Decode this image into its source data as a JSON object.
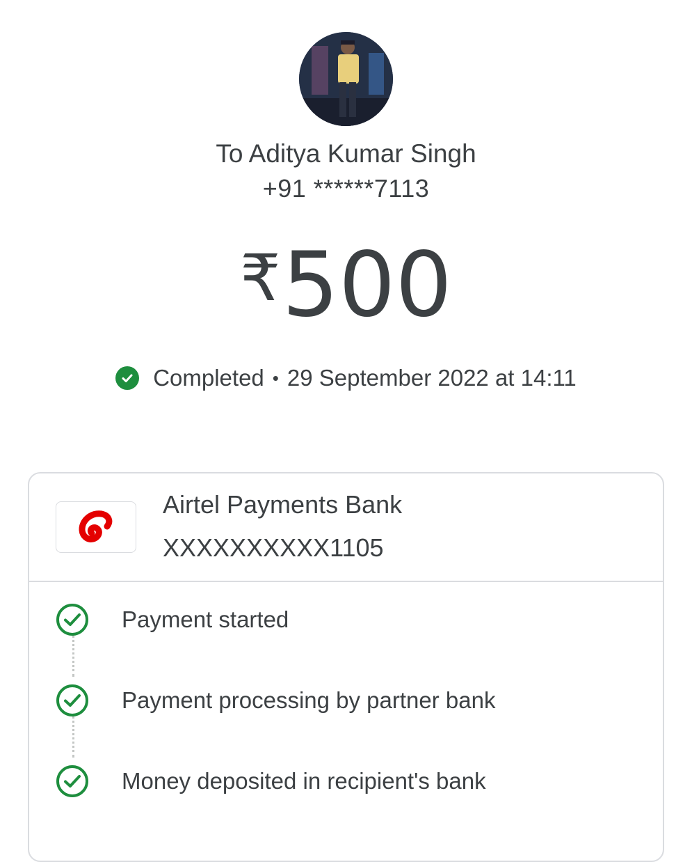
{
  "recipient": {
    "name": "To Aditya Kumar Singh",
    "phone": "+91 ******7113"
  },
  "payment": {
    "currency_symbol": "₹",
    "amount": "500",
    "status": "Completed",
    "separator": "•",
    "datetime": "29 September 2022 at 14:11"
  },
  "bank": {
    "name": "Airtel Payments Bank",
    "account": "XXXXXXXXXX1105",
    "logo_icon": "airtel-logo-icon"
  },
  "steps": [
    {
      "label": "Payment started"
    },
    {
      "label": "Payment processing by partner bank"
    },
    {
      "label": "Money deposited in recipient's bank"
    }
  ],
  "colors": {
    "success_green": "#1e8e3e",
    "text": "#3c4043",
    "brand_red": "#e40000",
    "border": "#dadce0"
  }
}
